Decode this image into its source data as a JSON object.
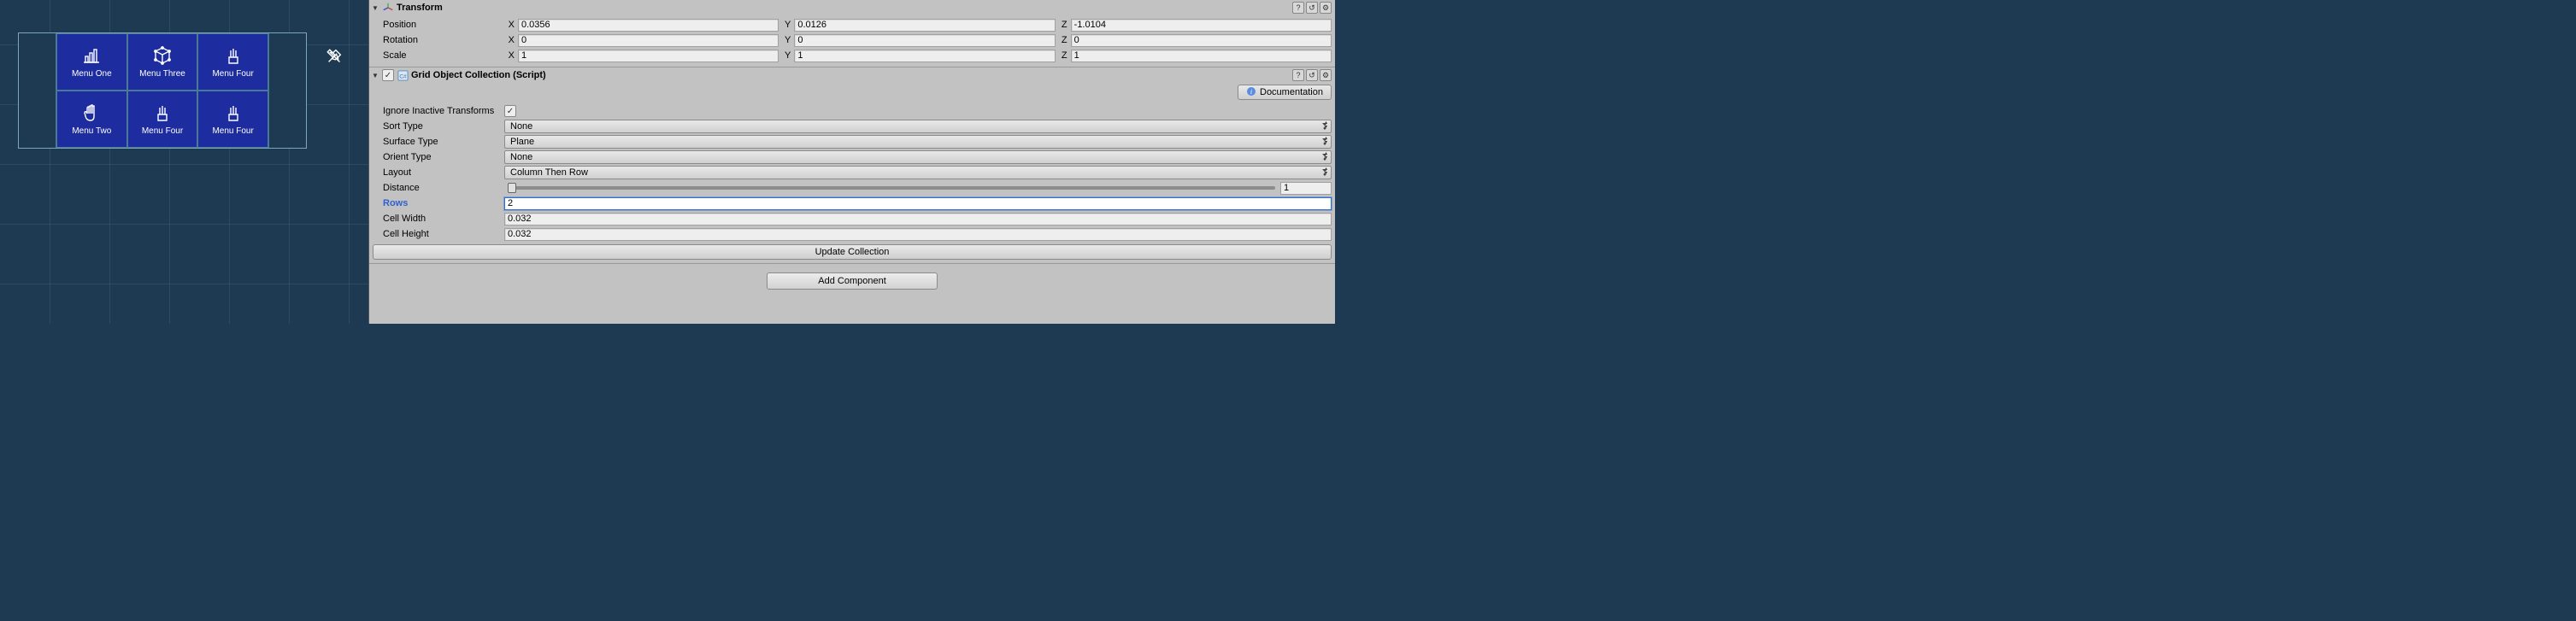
{
  "scene": {
    "menu_items": [
      {
        "label": "Menu One",
        "icon": "bar-chart"
      },
      {
        "label": "Menu Three",
        "icon": "cube"
      },
      {
        "label": "Menu Four",
        "icon": "brush"
      },
      {
        "label": "Menu Two",
        "icon": "hand"
      },
      {
        "label": "Menu Four",
        "icon": "brush"
      },
      {
        "label": "Menu Four",
        "icon": "brush"
      }
    ],
    "pin_icon": "pin"
  },
  "inspector": {
    "transform": {
      "title": "Transform",
      "position_label": "Position",
      "rotation_label": "Rotation",
      "scale_label": "Scale",
      "axis_x": "X",
      "axis_y": "Y",
      "axis_z": "Z",
      "position": {
        "x": "0.0356",
        "y": "0.0126",
        "z": "-1.0104"
      },
      "rotation": {
        "x": "0",
        "y": "0",
        "z": "0"
      },
      "scale": {
        "x": "1",
        "y": "1",
        "z": "1"
      }
    },
    "grid_collection": {
      "title": "Grid Object Collection (Script)",
      "doc_button": "Documentation",
      "labels": {
        "ignore_inactive": "Ignore Inactive Transforms",
        "sort_type": "Sort Type",
        "surface_type": "Surface Type",
        "orient_type": "Orient Type",
        "layout": "Layout",
        "distance": "Distance",
        "rows": "Rows",
        "cell_width": "Cell Width",
        "cell_height": "Cell Height",
        "update_collection": "Update Collection"
      },
      "values": {
        "ignore_inactive_checked": true,
        "sort_type": "None",
        "surface_type": "Plane",
        "orient_type": "None",
        "layout": "Column Then Row",
        "distance": "1",
        "rows": "2",
        "cell_width": "0.032",
        "cell_height": "0.032"
      }
    },
    "add_component": "Add Component"
  }
}
